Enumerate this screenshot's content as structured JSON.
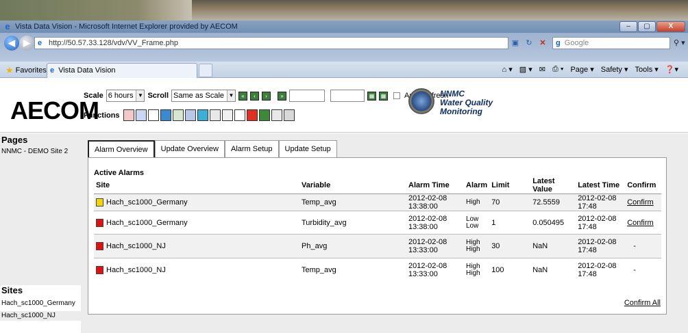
{
  "window": {
    "title": "Vista Data Vision - Microsoft Internet Explorer provided by AECOM",
    "minimize_label": "–",
    "maximize_label": "▢",
    "close_label": "X"
  },
  "address_bar": {
    "url": "http://50.57.33.128/vdv/VV_Frame.php",
    "search_placeholder": "Google"
  },
  "favorites_bar": {
    "favorites_label": "Favorites",
    "tab_label": "Vista Data Vision",
    "commands": [
      "Page ▾",
      "Safety ▾",
      "Tools ▾"
    ]
  },
  "app": {
    "logo_text": "AECOM",
    "scale_label": "Scale",
    "scale_value": "6 hours",
    "scroll_label": "Scroll",
    "scroll_value": "Same as Scale",
    "auto_refresh_label": "Auto Refresh",
    "functions_label": "Functions",
    "brand_line1": "NNMC",
    "brand_line2": "Water Quality",
    "brand_line3": "Monitoring"
  },
  "sidebar": {
    "pages_title": "Pages",
    "pages": [
      "NNMC - DEMO Site 2"
    ],
    "sites_title": "Sites",
    "sites": [
      "Hach_sc1000_Germany",
      "Hach_sc1000_NJ"
    ]
  },
  "tabs": [
    "Alarm Overview",
    "Update Overview",
    "Alarm Setup",
    "Update Setup"
  ],
  "alarms": {
    "section_title": "Active Alarms",
    "columns": [
      "Site",
      "Variable",
      "Alarm Time",
      "Alarm",
      "Limit",
      "Latest Value",
      "Latest Time",
      "Confirm"
    ],
    "rows": [
      {
        "status_color": "#f2d600",
        "site": "Hach_sc1000_Germany",
        "variable": "Temp_avg",
        "alarm_time": "2012-02-08 13:38:00",
        "alarm": "High",
        "limit": "70",
        "latest_value": "72.5559",
        "latest_time": "2012-02-08 17:48",
        "confirm": "Confirm"
      },
      {
        "status_color": "#e01010",
        "site": "Hach_sc1000_Germany",
        "variable": "Turbidity_avg",
        "alarm_time": "2012-02-08 13:38:00",
        "alarm": "Low Low",
        "limit": "1",
        "latest_value": "0.050495",
        "latest_time": "2012-02-08 17:48",
        "confirm": "Confirm"
      },
      {
        "status_color": "#e01010",
        "site": "Hach_sc1000_NJ",
        "variable": "Ph_avg",
        "alarm_time": "2012-02-08 13:33:00",
        "alarm": "High High",
        "limit": "30",
        "latest_value": "NaN",
        "latest_time": "2012-02-08 17:48",
        "confirm": "-"
      },
      {
        "status_color": "#e01010",
        "site": "Hach_sc1000_NJ",
        "variable": "Temp_avg",
        "alarm_time": "2012-02-08 13:33:00",
        "alarm": "High High",
        "limit": "100",
        "latest_value": "NaN",
        "latest_time": "2012-02-08 17:48",
        "confirm": "-"
      }
    ],
    "confirm_all_label": "Confirm All"
  }
}
